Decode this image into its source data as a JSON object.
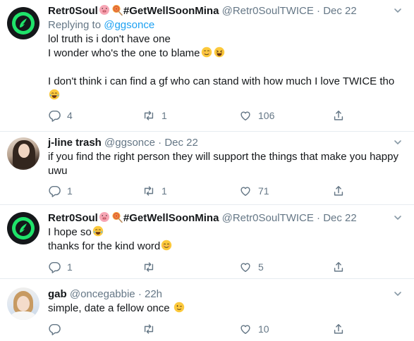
{
  "tweets": [
    {
      "author": "Retr0Soul",
      "hashtag": "#GetWellSoonMina",
      "handle": "@Retr0SoulTWICE",
      "dot": "·",
      "date": "Dec 22",
      "replying_prefix": "Replying to",
      "replying_handle": "@ggsonce",
      "lines": [
        "lol truth is i don't have one",
        "I wonder who's the one to blame",
        "",
        "I don't think i can find a gf who can stand with how much I love TWICE tho",
        ""
      ],
      "replies": "4",
      "retweets": "1",
      "likes": "106"
    },
    {
      "author": "j-line trash",
      "handle": "@ggsonce",
      "dot": "·",
      "date": "Dec 22",
      "lines": [
        "if you find the right person they will support the things that make you happy",
        "uwu"
      ],
      "replies": "1",
      "retweets": "1",
      "likes": "71"
    },
    {
      "author": "Retr0Soul",
      "hashtag": "#GetWellSoonMina",
      "handle": "@Retr0SoulTWICE",
      "dot": "·",
      "date": "Dec 22",
      "lines": [
        "I hope so",
        "thanks for the kind word"
      ],
      "replies": "1",
      "retweets": "",
      "likes": "5"
    },
    {
      "author": "gab",
      "handle": "@oncegabbie",
      "dot": "·",
      "date": "22h",
      "lines": [
        "simple, date a fellow once"
      ],
      "replies": "",
      "retweets": "",
      "likes": "10"
    }
  ],
  "icons": {
    "reply": "reply-icon",
    "retweet": "retweet-icon",
    "like": "heart-icon",
    "share": "share-icon",
    "more": "chevron-down-icon"
  },
  "colors": {
    "text": "#14171a",
    "muted": "#657786",
    "link": "#1da1f2",
    "separator": "#e6ecf0",
    "logo_green": "#1fe36a"
  }
}
